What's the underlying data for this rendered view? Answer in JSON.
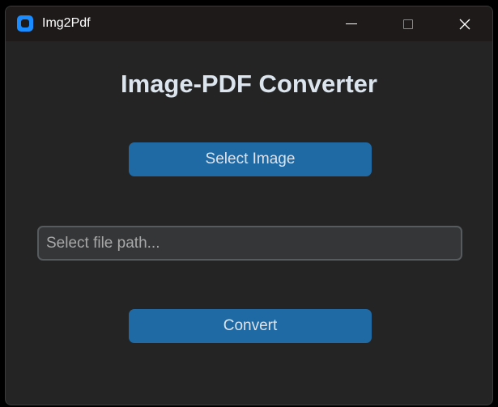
{
  "window": {
    "title": "Img2Pdf"
  },
  "titlebar": {
    "app_icon": "app-logo-icon",
    "minimize_icon": "minimize-icon",
    "maximize_icon": "maximize-icon",
    "close_icon": "close-icon",
    "close_glyph": "✕"
  },
  "main": {
    "heading": "Image-PDF Converter",
    "select_button_label": "Select Image",
    "path_input": {
      "placeholder": "Select file path...",
      "value": ""
    },
    "convert_button_label": "Convert"
  },
  "colors": {
    "accent": "#1f6aa5",
    "background": "#242424",
    "titlebar": "#1f1a1a",
    "app_icon": "#1a8cff",
    "text": "#dce4ee",
    "input_bg": "#343638",
    "input_border": "#565b5e"
  }
}
